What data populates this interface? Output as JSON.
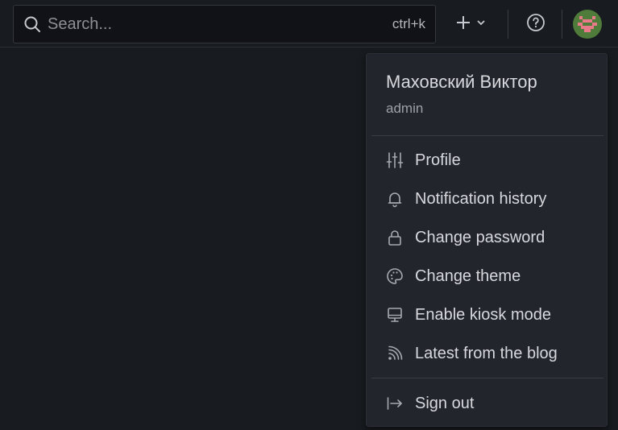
{
  "topbar": {
    "search": {
      "placeholder": "Search...",
      "shortcut": "ctrl+k"
    },
    "add_label": "+",
    "icons": {
      "search": "search-icon",
      "add": "plus-icon",
      "chevron": "chevron-down-icon",
      "help": "help-icon",
      "avatar": "user-avatar"
    }
  },
  "profile_menu": {
    "user_name": "Маховский Виктор",
    "user_role": "admin",
    "items": [
      {
        "label": "Profile",
        "icon": "sliders-icon"
      },
      {
        "label": "Notification history",
        "icon": "bell-icon"
      },
      {
        "label": "Change password",
        "icon": "lock-icon"
      },
      {
        "label": "Change theme",
        "icon": "palette-icon"
      },
      {
        "label": "Enable kiosk mode",
        "icon": "monitor-icon"
      },
      {
        "label": "Latest from the blog",
        "icon": "rss-icon"
      }
    ],
    "sign_out": {
      "label": "Sign out",
      "icon": "sign-out-icon"
    }
  },
  "colors": {
    "background": "#181b1f",
    "menu_background": "#22252b",
    "text": "#d8d9df",
    "muted_text": "#9fa0a8"
  }
}
